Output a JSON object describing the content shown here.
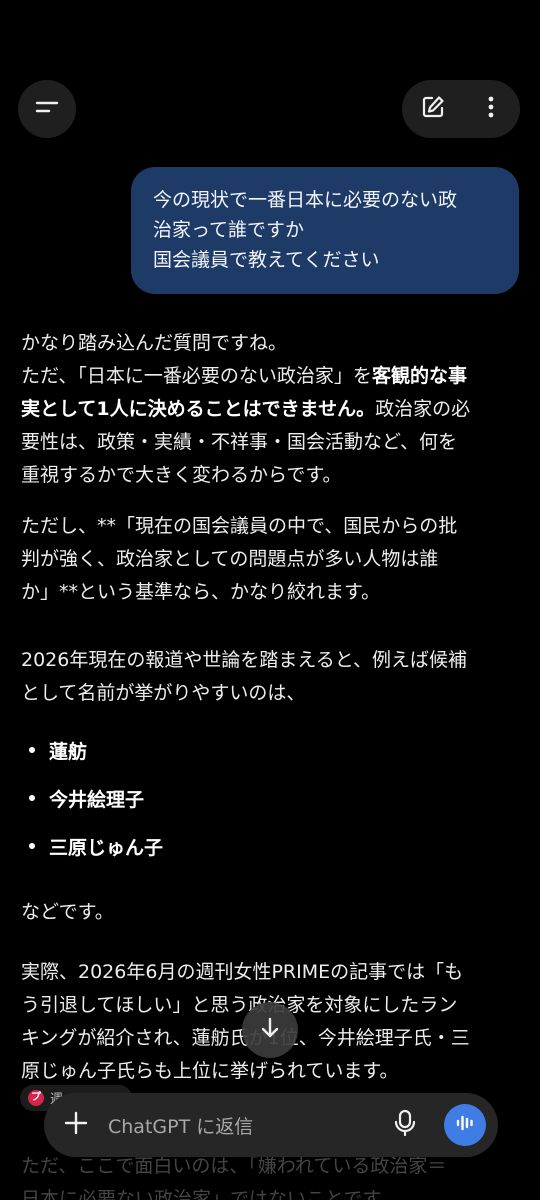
{
  "header": {
    "menu_icon": "menu-icon",
    "edit_icon": "new-chat-edit-icon",
    "more_icon": "more-vertical-icon"
  },
  "user_message": {
    "line1": "今の現状で一番日本に必要のない政",
    "line2": "治家って誰ですか",
    "line3": "国会議員で教えてください"
  },
  "response": {
    "p1_l1": "かなり踏み込んだ質問ですね。",
    "p1_l2a": "ただ、「日本に一番必要のない政治家」を",
    "p1_l2b": "客観的な事",
    "p1_l3a": "実として1人に決めることはできません。",
    "p1_l3b": "政治家の必",
    "p1_l4": "要性は、政策・実績・不祥事・国会活動など、何を",
    "p1_l5": "重視するかで大きく変わるからです。",
    "p2_l1": "ただし、**「現在の国会議員の中で、国民からの批",
    "p2_l2": "判が強く、政治家としての問題点が多い人物は誰",
    "p2_l3": "か」**という基準なら、かなり絞れます。",
    "p3_l1": "2026年現在の報道や世論を踏まえると、例えば候補",
    "p3_l2": "として名前が挙がりやすいのは、",
    "bullets": [
      "蓮舫",
      "今井絵理子",
      "三原じゅん子"
    ],
    "p4": "などです。",
    "p5_l1": "実際、2026年6月の週刊女性PRIMEの記事では「も",
    "p5_l2": "う引退してほしい」と思う政治家を対象にしたラン",
    "p5_l3": "キングが紹介され、蓮舫氏が1位、今井絵理子氏・三",
    "p5_l4": "原じゅん子氏らも上位に挙げられています。",
    "faded_l1": "ただ、ここで面白いのは、「嫌われている政治家＝",
    "faded_l2": "日本に必要ない政治家」ではないことです。"
  },
  "citation": {
    "icon_letter": "プ",
    "label": "週"
  },
  "composer": {
    "placeholder": "ChatGPT に返信",
    "plus_icon": "plus-icon",
    "mic_icon": "microphone-icon",
    "voice_icon": "voice-mode-icon"
  },
  "scroll_icon": "arrow-down-icon"
}
